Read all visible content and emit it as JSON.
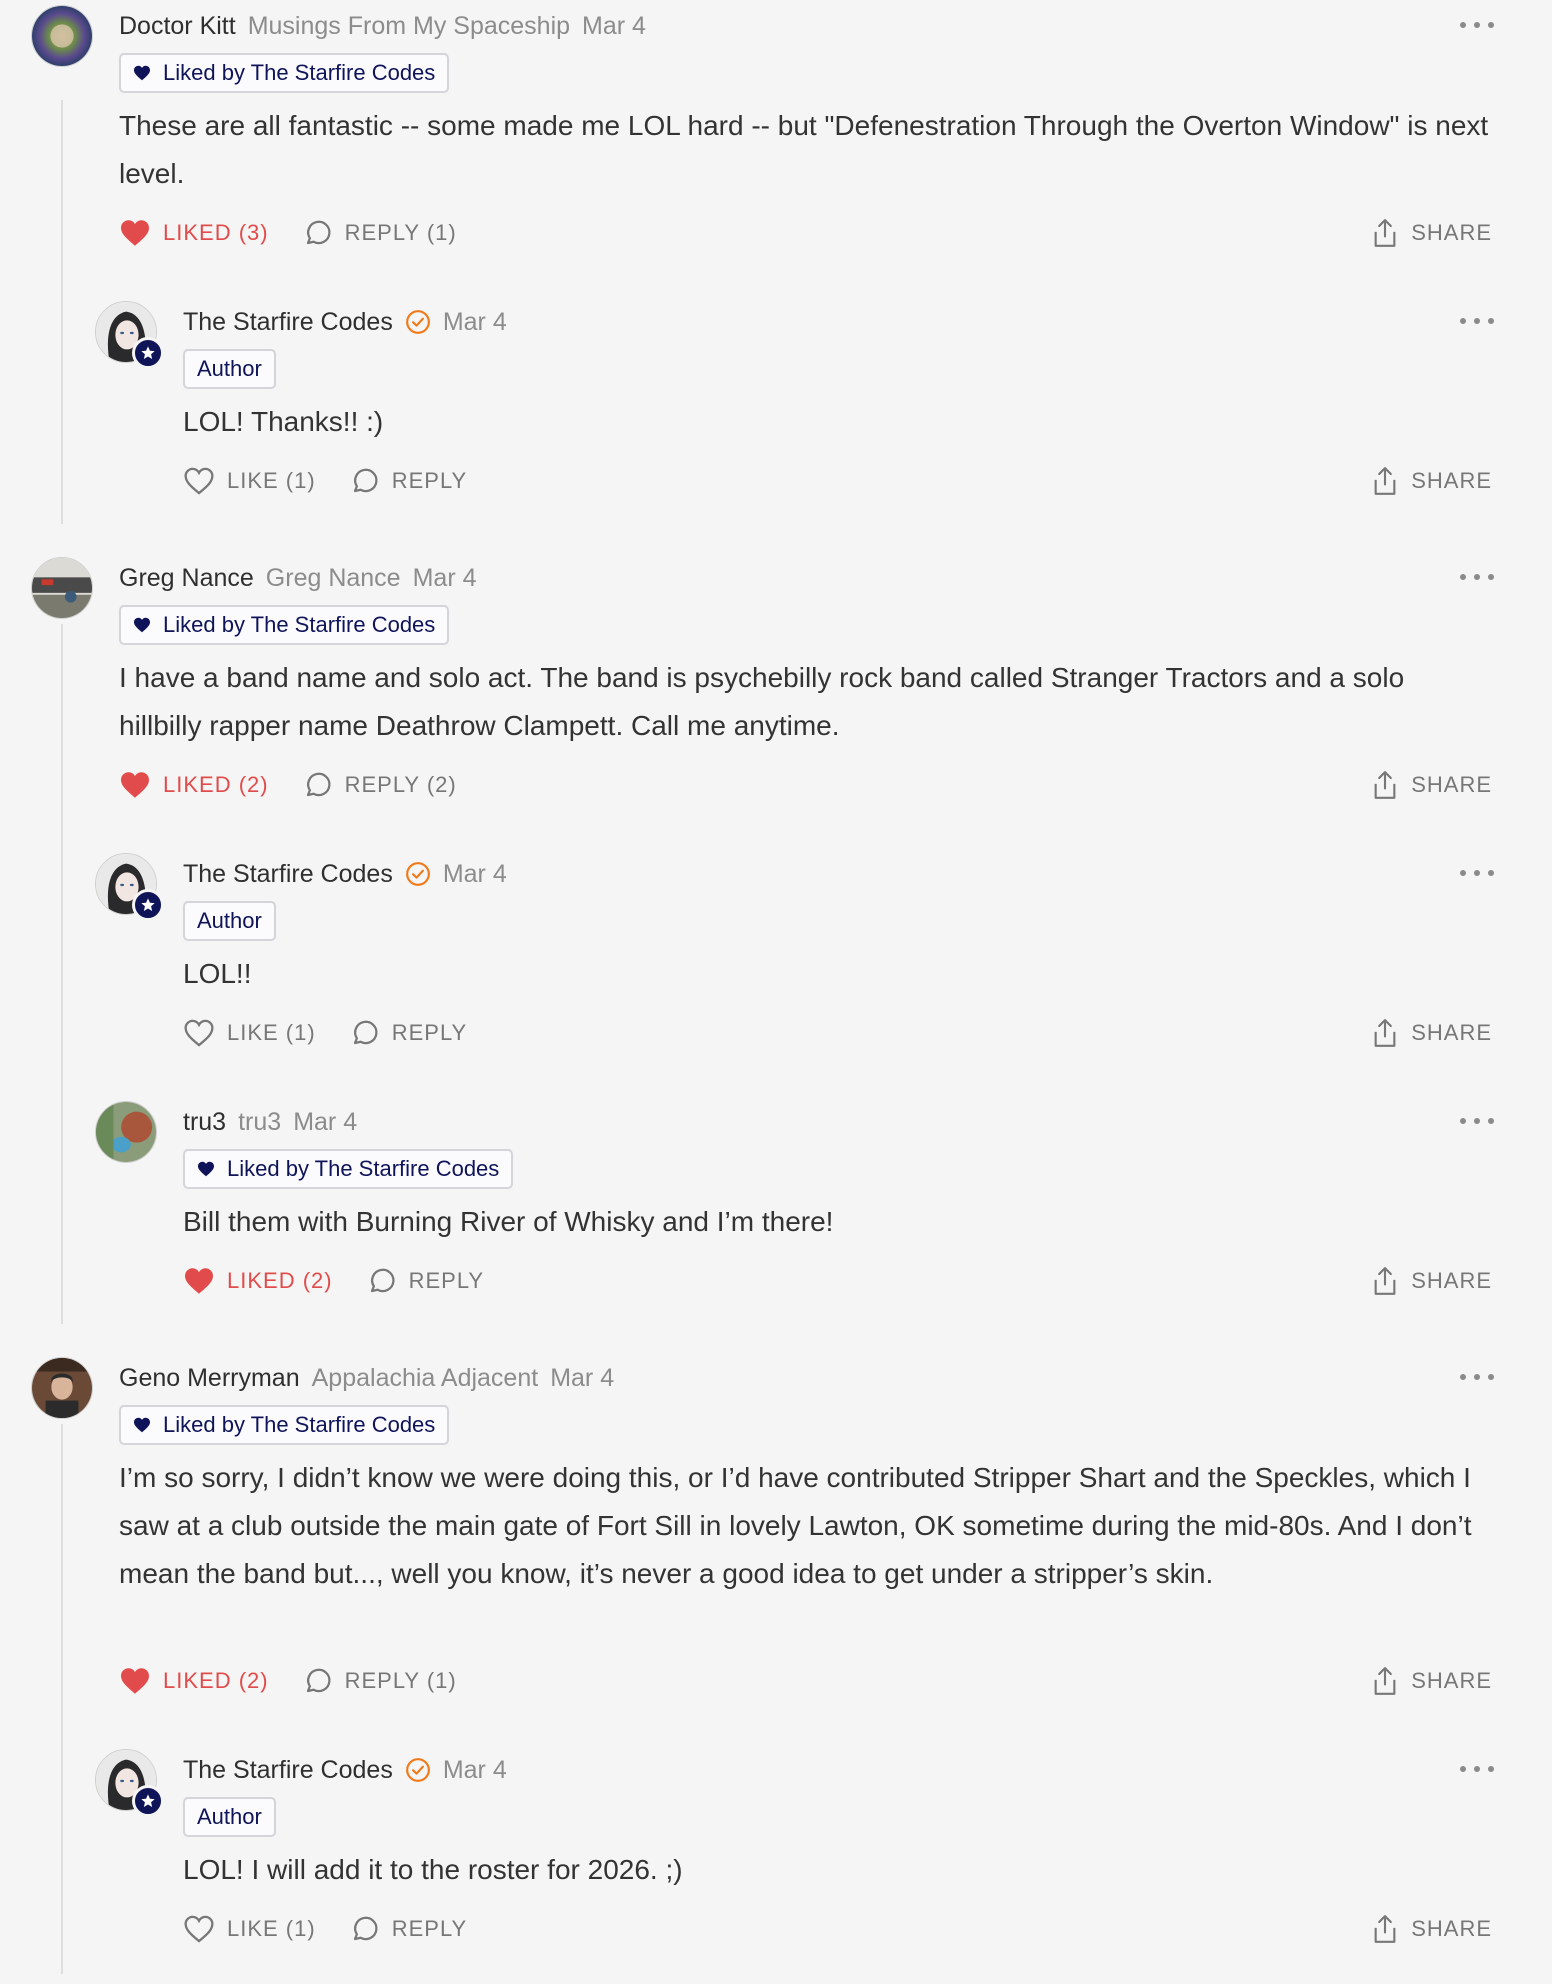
{
  "colors": {
    "background": "#f5f5f5",
    "liked_red": "#e24b4b",
    "navy": "#0f1459",
    "verified_orange": "#f07a1a",
    "muted_text": "#8c8c8c"
  },
  "icons": {
    "heart": "heart-icon",
    "reply": "reply-bubble-icon",
    "share": "share-icon",
    "more": "more-dots-icon",
    "verified": "verified-check-icon",
    "author_star": "star-badge-icon"
  },
  "comments": [
    {
      "name": "Doctor Kitt",
      "publication": "Musings From My Spaceship",
      "date": "Mar 4",
      "tag": "Liked by The Starfire Codes",
      "text": "These are all fantastic -- some made me LOL hard -- but \"Defenestration Through the Overton Window\" is next level.",
      "like_label": "LIKED (3)",
      "reply_label": "REPLY (1)",
      "share_label": "SHARE"
    },
    {
      "name": "The Starfire Codes",
      "date": "Mar 4",
      "tag": "Author",
      "text": "LOL! Thanks!! :)",
      "like_label": "LIKE (1)",
      "reply_label": "REPLY",
      "share_label": "SHARE"
    },
    {
      "name": "Greg Nance",
      "publication": "Greg Nance",
      "date": "Mar 4",
      "tag": "Liked by The Starfire Codes",
      "text": "I have a band name and solo act. The band is psychebilly rock band called Stranger Tractors and a solo hillbilly rapper name Deathrow Clampett. Call me anytime.",
      "like_label": "LIKED (2)",
      "reply_label": "REPLY (2)",
      "share_label": "SHARE"
    },
    {
      "name": "The Starfire Codes",
      "date": "Mar 4",
      "tag": "Author",
      "text": "LOL!!",
      "like_label": "LIKE (1)",
      "reply_label": "REPLY",
      "share_label": "SHARE"
    },
    {
      "name": "tru3",
      "publication": "tru3",
      "date": "Mar 4",
      "tag": "Liked by The Starfire Codes",
      "text": "Bill them with Burning River of Whisky and I’m there!",
      "like_label": "LIKED (2)",
      "reply_label": "REPLY",
      "share_label": "SHARE"
    },
    {
      "name": "Geno Merryman",
      "publication": "Appalachia Adjacent",
      "date": "Mar 4",
      "tag": "Liked by The Starfire Codes",
      "text": "I’m so sorry, I didn’t know we were doing this, or I’d have contributed Stripper Shart and the Speckles, which I saw at a club outside the main gate of Fort Sill in lovely Lawton, OK sometime during the mid-80s. And I don’t mean the band but..., well you know, it’s never a good idea to get under a stripper’s skin.",
      "like_label": "LIKED (2)",
      "reply_label": "REPLY (1)",
      "share_label": "SHARE"
    },
    {
      "name": "The Starfire Codes",
      "date": "Mar 4",
      "tag": "Author",
      "text": "LOL! I will add it to the roster for 2026. ;)",
      "like_label": "LIKE (1)",
      "reply_label": "REPLY",
      "share_label": "SHARE"
    }
  ]
}
